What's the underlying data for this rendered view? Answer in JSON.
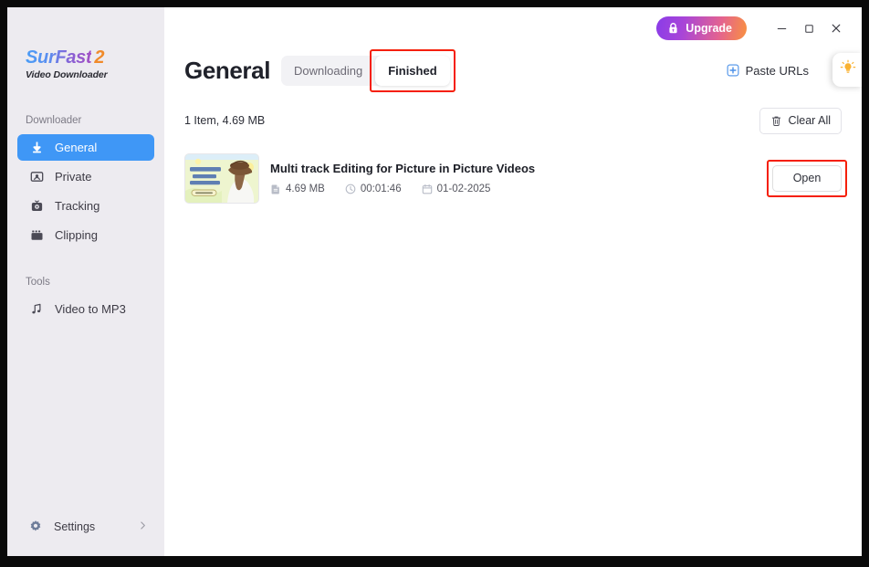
{
  "app": {
    "brand_main": "SurFast",
    "brand_accent": "2",
    "brand_sub": "Video Downloader",
    "accent_blue": "#3f97f6",
    "accent_orange": "#f08a2a",
    "annotation_color": "#f51f07"
  },
  "titlebar": {
    "upgrade_label": "Upgrade",
    "upgrade_icon": "lock-icon",
    "minimize_icon": "minimize-icon",
    "maximize_icon": "maximize-icon",
    "close_icon": "close-icon"
  },
  "sidebar": {
    "sections": [
      {
        "label": "Downloader",
        "items": [
          {
            "label": "General",
            "icon": "download-arrow-icon",
            "active": true
          },
          {
            "label": "Private",
            "icon": "private-card-icon",
            "active": false
          },
          {
            "label": "Tracking",
            "icon": "tracking-camera-icon",
            "active": false
          },
          {
            "label": "Clipping",
            "icon": "clipping-film-icon",
            "active": false
          }
        ]
      },
      {
        "label": "Tools",
        "items": [
          {
            "label": "Video to MP3",
            "icon": "music-note-icon",
            "active": false
          }
        ]
      }
    ],
    "settings": {
      "label": "Settings",
      "icon": "gear-icon",
      "chevron": "chevron-right-icon"
    }
  },
  "header": {
    "title": "General",
    "tabs": [
      {
        "label": "Downloading",
        "active": false,
        "annotated": false
      },
      {
        "label": "Finished",
        "active": true,
        "annotated": true
      }
    ],
    "paste_urls_label": "Paste URLs",
    "paste_urls_icon": "plus-square-icon",
    "tip_icon": "lightbulb-icon"
  },
  "toolbar": {
    "item_summary": "1 Item, 4.69 MB",
    "clear_all_label": "Clear All",
    "clear_all_icon": "trash-icon"
  },
  "downloads": {
    "items": [
      {
        "title": "Multi track Editing for Picture in Picture Videos",
        "size": "4.69 MB",
        "size_icon": "file-icon",
        "duration": "00:01:46",
        "duration_icon": "clock-icon",
        "date": "01-02-2025",
        "date_icon": "calendar-icon",
        "action_label": "Open",
        "action_annotated": true,
        "thumbnail_alt": "video thumbnail"
      }
    ]
  }
}
